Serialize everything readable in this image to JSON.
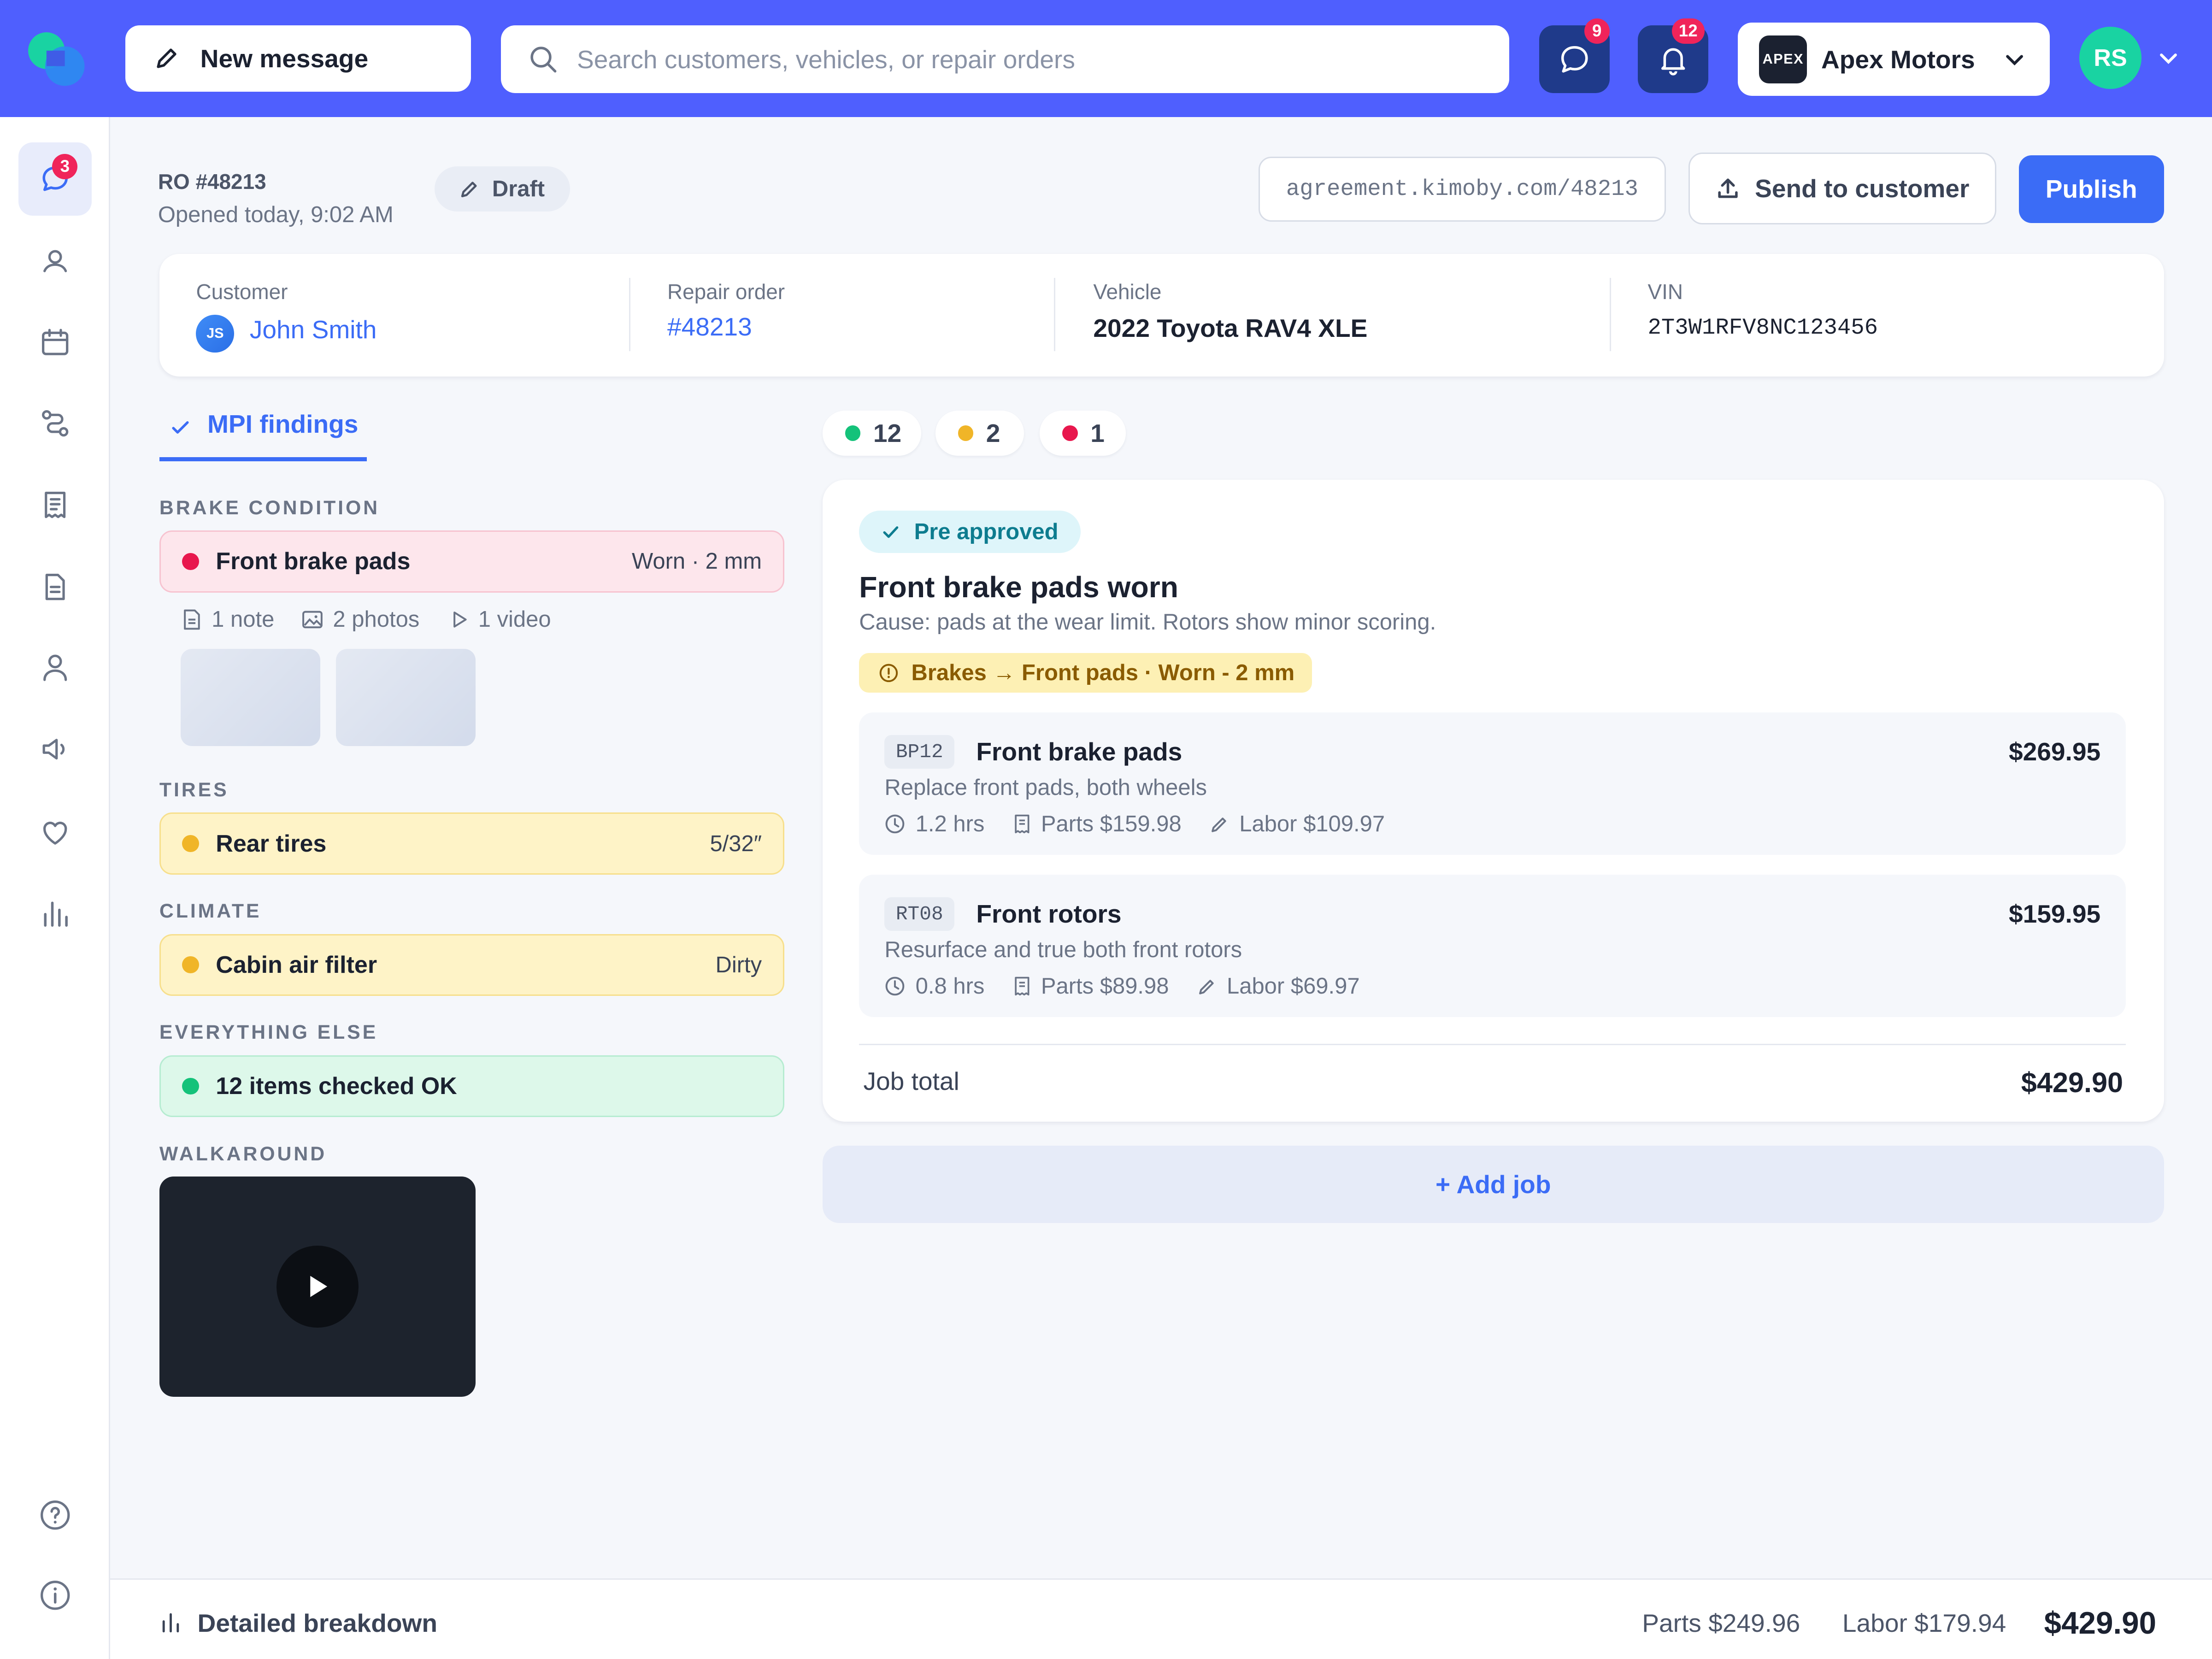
{
  "topbar": {
    "new_message_label": "New message",
    "search_placeholder": "Search customers, vehicles, or repair orders",
    "messages_badge": "9",
    "notifications_badge": "12",
    "shop_logo_text": "APEX",
    "shop_name": "Apex Motors",
    "avatar_initials": "RS"
  },
  "sidebar": {
    "chat_badge": "3",
    "items": [
      "chat-icon",
      "customers-icon",
      "calendar-icon",
      "workflow-icon",
      "receipt-icon",
      "document-icon",
      "user-icon",
      "megaphone-icon",
      "heart-icon",
      "reports-icon",
      "help-icon",
      "info-icon"
    ]
  },
  "header": {
    "ro_number": "RO #48213",
    "opened": "Opened today, 9:02 AM",
    "status": "Draft",
    "agreement_url": "agreement.kimoby.com/48213",
    "send_label": "Send to customer",
    "publish_label": "Publish"
  },
  "info": {
    "customer_label": "Customer",
    "customer_initials": "JS",
    "customer_name": "John Smith",
    "ro_label": "Repair order",
    "ro_value": "#48213",
    "vehicle_label": "Vehicle",
    "vehicle_value": "2022 Toyota RAV4 XLE",
    "vin_label": "VIN",
    "vin_value": "2T3W1RFV8NC123456"
  },
  "mpi": {
    "tab_label": "MPI findings",
    "brake_title": "BRAKE CONDITION",
    "brake_item": {
      "name": "Front brake pads",
      "value": "Worn · 2 mm"
    },
    "brake_note": "1 note",
    "brake_photos": "2 photos",
    "brake_video": "1 video",
    "tires_title": "TIRES",
    "tires_item": {
      "name": "Rear tires",
      "value": "5/32″"
    },
    "climate_title": "CLIMATE",
    "climate_item": {
      "name": "Cabin air filter",
      "value": "Dirty"
    },
    "else_title": "EVERYTHING ELSE",
    "else_item": {
      "name": "12 items checked OK"
    },
    "walk_title": "WALKAROUND"
  },
  "status_counts": {
    "green": "12",
    "yellow": "2",
    "red": "1"
  },
  "job": {
    "approval": "Pre approved",
    "title": "Front brake pads worn",
    "cause": "Cause: pads at the wear limit. Rotors show minor scoring.",
    "tag": "Brakes → Front pads · Worn - 2 mm",
    "lines": [
      {
        "code": "BP12",
        "name": "Front brake pads",
        "price": "$269.95",
        "desc": "Replace front pads, both wheels",
        "hours": "1.2 hrs",
        "parts": "Parts $159.98",
        "labor": "Labor $109.97"
      },
      {
        "code": "RT08",
        "name": "Front rotors",
        "price": "$159.95",
        "desc": "Resurface and true both front rotors",
        "hours": "0.8 hrs",
        "parts": "Parts $89.98",
        "labor": "Labor $69.97"
      }
    ],
    "total_label": "Job total",
    "total_value": "$429.90",
    "add_job": "+ Add job"
  },
  "footer": {
    "breakdown_label": "Detailed breakdown",
    "parts": "Parts $249.96",
    "labor": "Labor $179.94",
    "total": "$429.90"
  },
  "colors": {
    "brand": "#4f5ffe",
    "primary": "#3b6cf6",
    "red": "#e8174d",
    "yellow": "#f0b528",
    "green": "#14c27a"
  }
}
